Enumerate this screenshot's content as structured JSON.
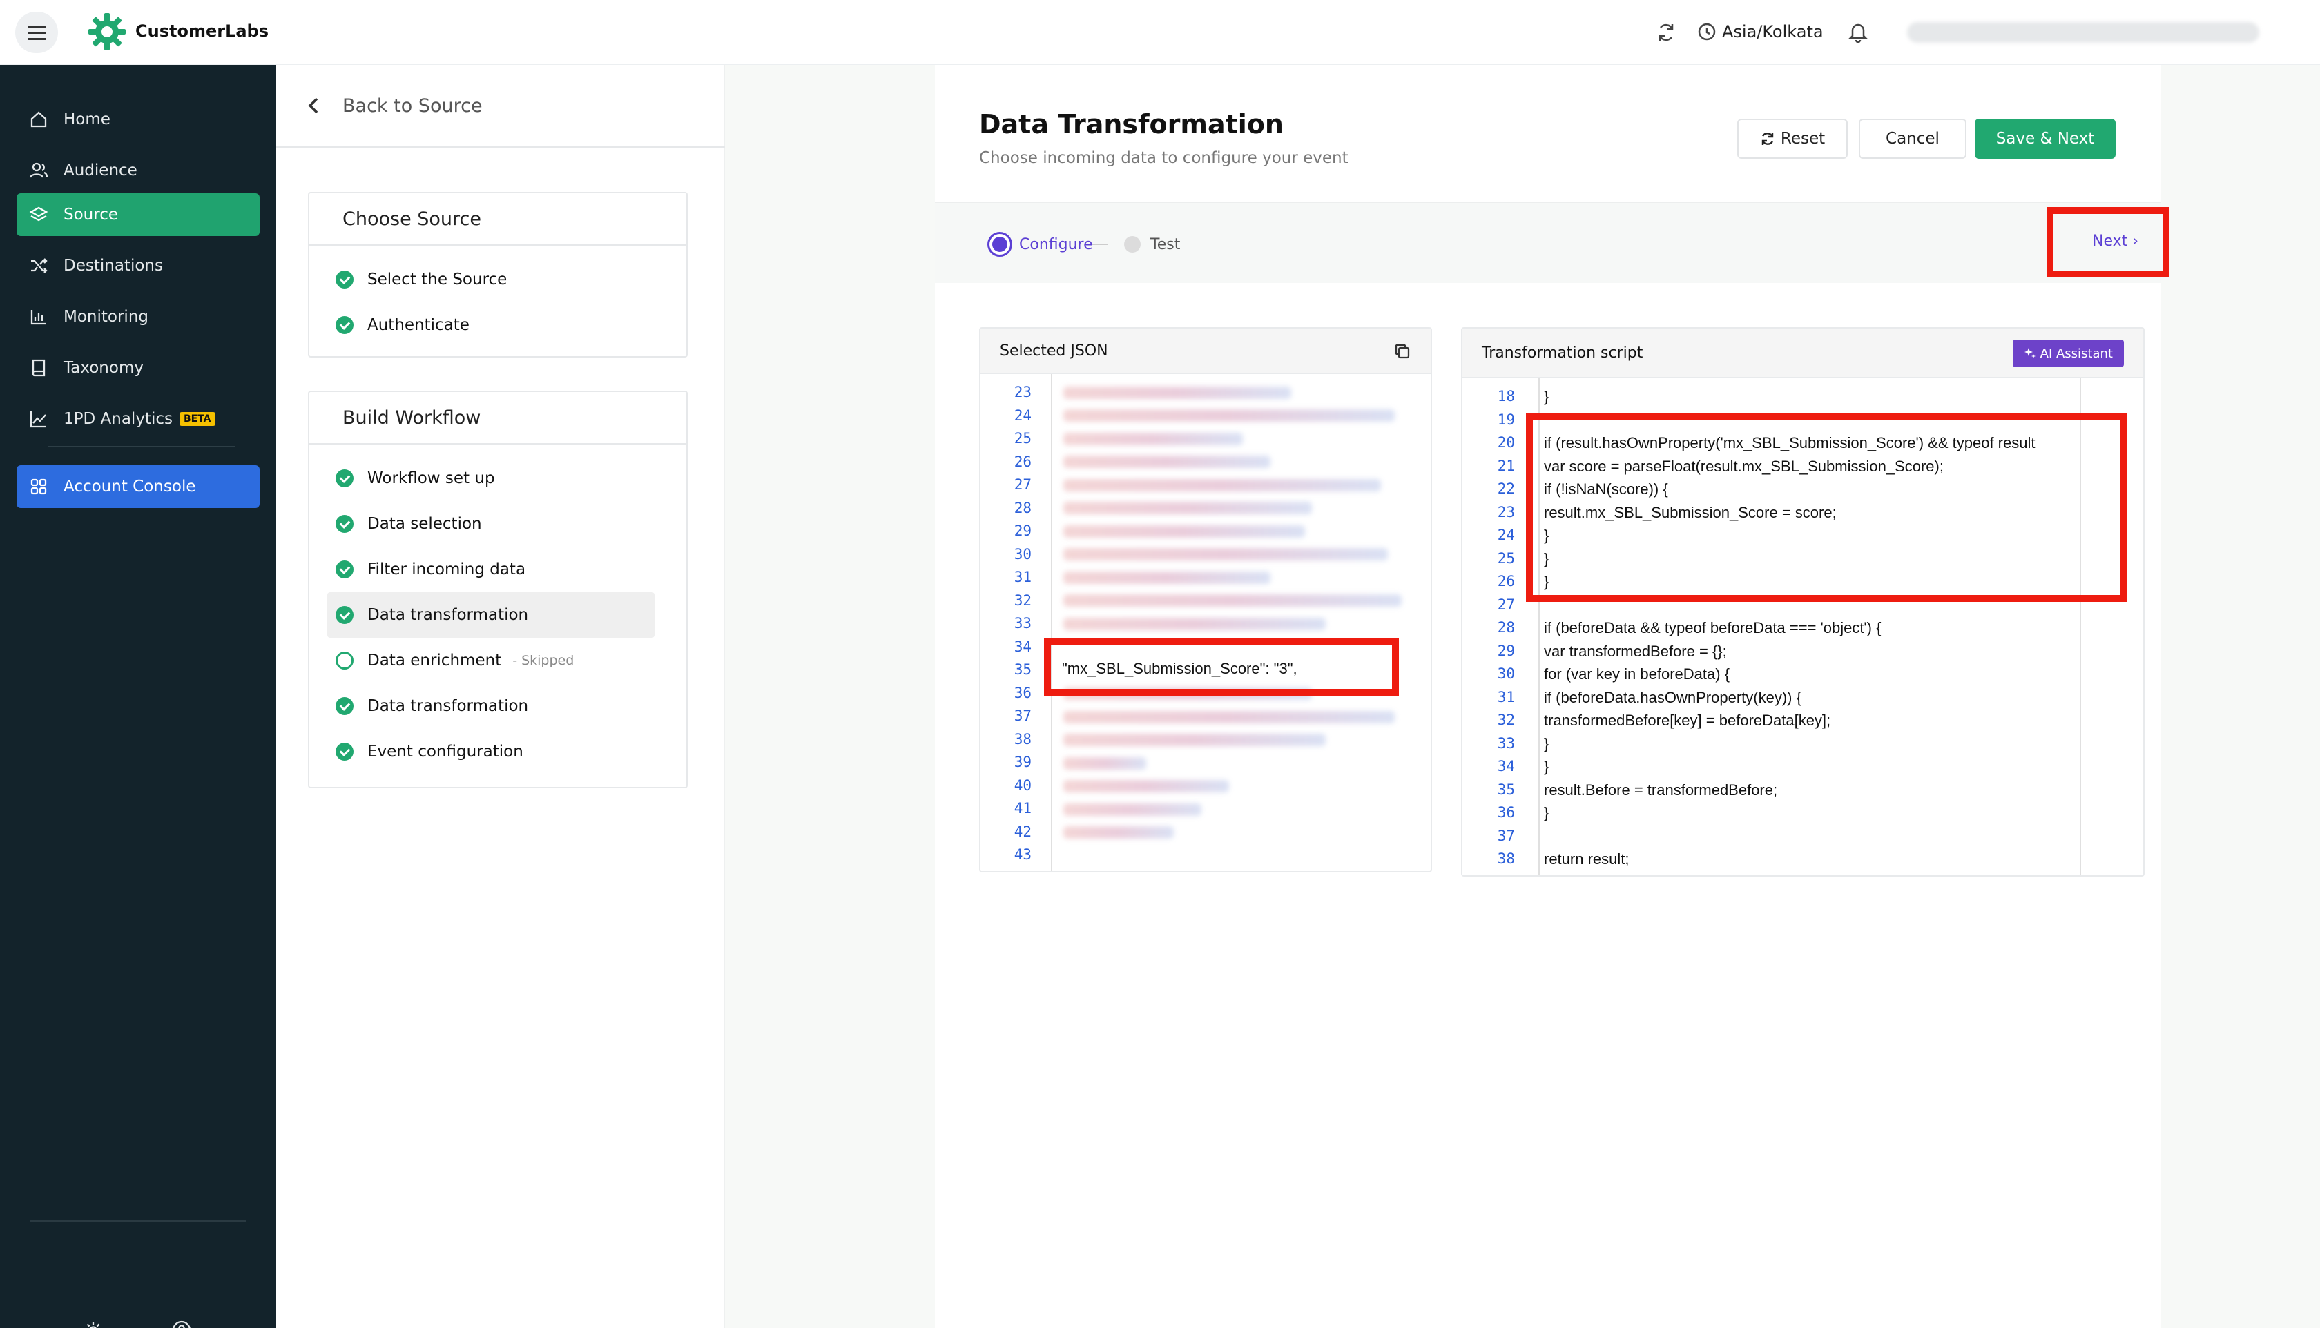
{
  "brand": {
    "name": "CustomerLabs",
    "accent": "#21a870"
  },
  "header": {
    "timezone": "Asia/Kolkata",
    "icons": [
      "sync-icon",
      "clock-icon",
      "bell-icon"
    ]
  },
  "sidebar": {
    "items": [
      {
        "label": "Home",
        "icon": "home-icon"
      },
      {
        "label": "Audience",
        "icon": "users-icon"
      },
      {
        "label": "Source",
        "icon": "layers-icon",
        "active": true
      },
      {
        "label": "Destinations",
        "icon": "shuffle-icon"
      },
      {
        "label": "Monitoring",
        "icon": "bar-chart-icon"
      },
      {
        "label": "Taxonomy",
        "icon": "book-icon"
      },
      {
        "label": "1PD Analytics",
        "icon": "trend-icon",
        "badge": "BETA"
      }
    ],
    "console": {
      "label": "Account Console",
      "icon": "grid-icon"
    },
    "bottom_icons": [
      "settings-icon",
      "help-icon"
    ]
  },
  "steps": {
    "back_label": "Back to Source",
    "choose_source": {
      "title": "Choose Source",
      "items": [
        {
          "label": "Select the Source",
          "status": "done"
        },
        {
          "label": "Authenticate",
          "status": "done"
        }
      ]
    },
    "build_workflow": {
      "title": "Build Workflow",
      "items": [
        {
          "label": "Workflow set up",
          "status": "done"
        },
        {
          "label": "Data selection",
          "status": "done"
        },
        {
          "label": "Filter incoming data",
          "status": "done"
        },
        {
          "label": "Data transformation",
          "status": "done",
          "current": true
        },
        {
          "label": "Data enrichment",
          "status": "open",
          "note": "- Skipped"
        },
        {
          "label": "Data transformation",
          "status": "done"
        },
        {
          "label": "Event configuration",
          "status": "done"
        }
      ]
    }
  },
  "main": {
    "title": "Data Transformation",
    "subtitle": "Choose incoming data to configure your event",
    "buttons": {
      "reset": "Reset",
      "cancel": "Cancel",
      "save": "Save & Next"
    },
    "stepper": {
      "configure": "Configure",
      "test": "Test",
      "next": "Next ›"
    },
    "json_panel": {
      "title": "Selected JSON",
      "line_numbers": [
        "23",
        "24",
        "25",
        "26",
        "27",
        "28",
        "29",
        "30",
        "31",
        "32",
        "33",
        "34",
        "35",
        "36",
        "37",
        "38",
        "39",
        "40",
        "41",
        "42",
        "43"
      ],
      "visible_line": "\"mx_SBL_Submission_Score\": \"3\","
    },
    "script_panel": {
      "title": "Transformation script",
      "ai_button": "AI Assistant",
      "line_numbers": [
        "18",
        "19",
        "20",
        "21",
        "22",
        "23",
        "24",
        "25",
        "26",
        "27",
        "28",
        "29",
        "30",
        "31",
        "32",
        "33",
        "34",
        "35",
        "36",
        "37",
        "38"
      ],
      "lines": [
        "}",
        "",
        "if (result.hasOwnProperty('mx_SBL_Submission_Score') && typeof result",
        "var score = parseFloat(result.mx_SBL_Submission_Score);",
        "if (!isNaN(score)) {",
        "result.mx_SBL_Submission_Score = score;",
        "}",
        "}",
        "}",
        "",
        "if (beforeData && typeof beforeData === 'object') {",
        "var transformedBefore = {};",
        "for (var key in beforeData) {",
        "if (beforeData.hasOwnProperty(key)) {",
        "transformedBefore[key] = beforeData[key];",
        "}",
        "}",
        "result.Before = transformedBefore;",
        "}",
        "",
        "return result;"
      ]
    }
  }
}
